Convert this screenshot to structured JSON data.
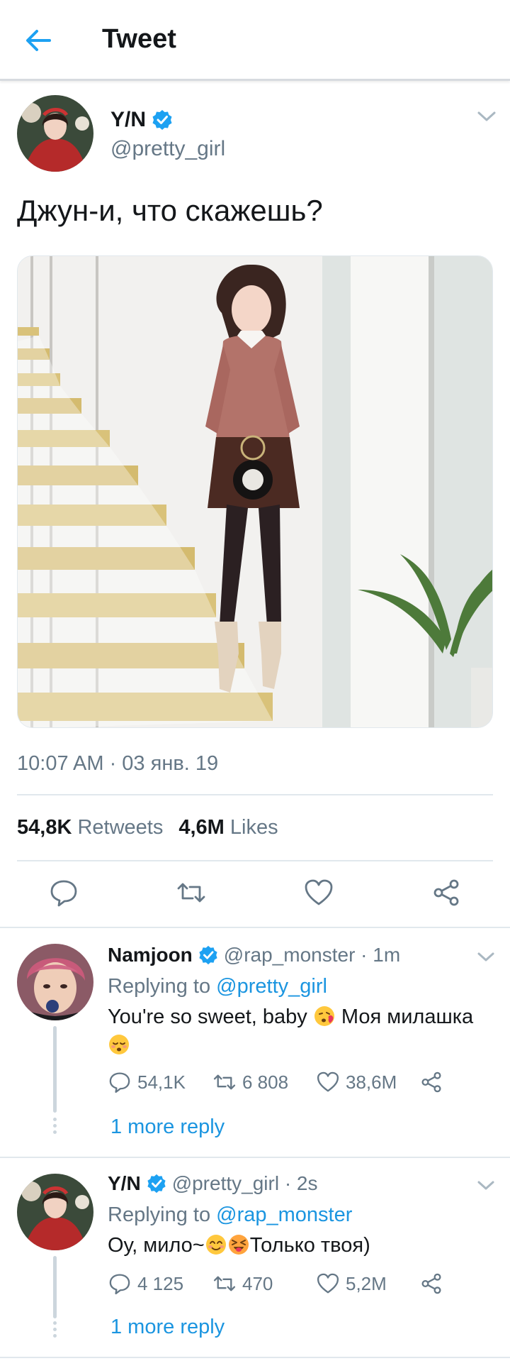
{
  "header": {
    "title": "Tweet",
    "back_icon": "arrow-left-icon"
  },
  "colors": {
    "accent": "#1da1f2",
    "link": "#1b95e0",
    "muted": "#657786",
    "text": "#14171a",
    "divider": "#e1e8ed"
  },
  "tweet": {
    "name": "Y/N",
    "handle": "@pretty_girl",
    "text": "Джун-и, что скажешь?",
    "timestamp": "10:07 AM · 03 янв. 19",
    "stats": {
      "retweets_count": "54,8K",
      "retweets_label": "Retweets",
      "likes_count": "4,6M",
      "likes_label": "Likes"
    },
    "actions": [
      "reply-icon",
      "retweet-icon",
      "like-icon",
      "share-icon"
    ]
  },
  "replies": [
    {
      "name": "Namjoon",
      "handle_time": "@rap_monster · 1m",
      "replying_prefix": "Replying to",
      "replying_to": "@pretty_girl",
      "text_line1": "You're so sweet, baby",
      "text_line1_tail": "Моя милашка",
      "replies_count": "54,1K",
      "retweets_count": "6 808",
      "likes_count": "38,6M",
      "more_reply": "1 more reply"
    },
    {
      "name": "Y/N",
      "handle_time": "@pretty_girl · 2s",
      "replying_prefix": "Replying to",
      "replying_to": "@rap_monster",
      "text_head": "Оу, мило~",
      "text_tail": "Только твоя)",
      "replies_count": "4 125",
      "retweets_count": "470",
      "likes_count": "5,2M",
      "more_reply": "1 more reply"
    }
  ]
}
